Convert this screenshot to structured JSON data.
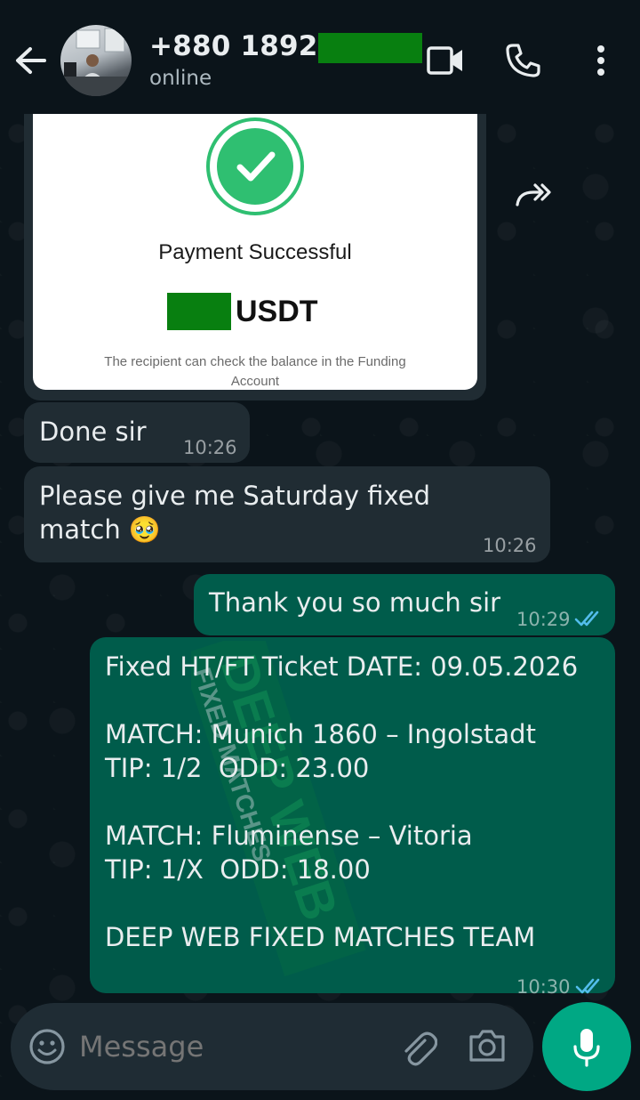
{
  "header": {
    "contact_name": "+880 1892-1",
    "status": "online"
  },
  "image_message": {
    "title": "Payment Successful",
    "currency": "USDT",
    "note_line1": "The recipient can check the balance in the Funding",
    "note_line2": "Account"
  },
  "messages": [
    {
      "text": "Done sir",
      "time": "10:26"
    },
    {
      "text_line1": "Please give me Saturday fixed",
      "text_line2": "match 🥹",
      "time": "10:26"
    },
    {
      "text": "Thank you so much sir",
      "time": "10:29"
    },
    {
      "text": "Fixed HT/FT Ticket DATE: 09.05.2026\n\nMATCH: Munich 1860 – Ingolstadt\nTIP: 1/2  ODD: 23.00\n\nMATCH: Fluminense – Vitoria\nTIP: 1/X  ODD: 18.00\n\nDEEP WEB FIXED MATCHES TEAM",
      "time": "10:30",
      "watermark_main": "DEEP WEB",
      "watermark_sub": "FIXED MATCHES"
    }
  ],
  "composer": {
    "placeholder": "Message"
  },
  "colors": {
    "outgoing_bubble": "#005c4b",
    "incoming_bubble": "#202c33",
    "read_ticks": "#53bdeb",
    "accent": "#00a884",
    "redaction": "#087f10"
  }
}
